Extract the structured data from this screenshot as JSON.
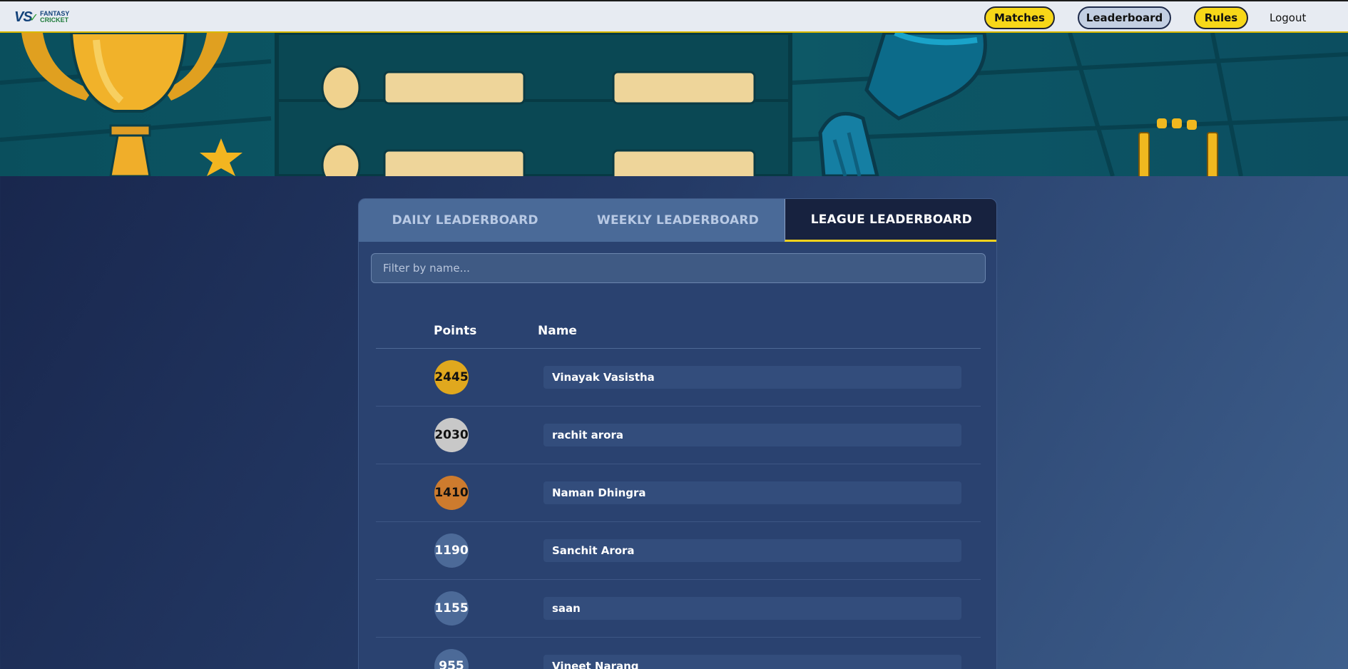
{
  "nav": {
    "logo_text": "VS",
    "logo_brand_top": "FANTASY",
    "logo_brand_bottom": "CRICKET",
    "matches_label": "Matches",
    "leaderboard_label": "Leaderboard",
    "rules_label": "Rules",
    "logout_label": "Logout"
  },
  "tabs": [
    {
      "label": "DAILY LEADERBOARD",
      "active": false
    },
    {
      "label": "WEEKLY LEADERBOARD",
      "active": false
    },
    {
      "label": "LEAGUE LEADERBOARD",
      "active": true
    }
  ],
  "filter": {
    "placeholder": "Filter by name...",
    "value": ""
  },
  "table": {
    "headers": {
      "points": "Points",
      "name": "Name"
    },
    "rows": [
      {
        "points": "2445",
        "name": "Vinayak Vasistha",
        "badge_color": "#e0a81e"
      },
      {
        "points": "2030",
        "name": "rachit arora",
        "badge_color": "#c8c8c8"
      },
      {
        "points": "1410",
        "name": "Naman Dhingra",
        "badge_color": "#cd7b2e"
      },
      {
        "points": "1190",
        "name": "Sanchit Arora",
        "badge_color": "#4c6a98"
      },
      {
        "points": "1155",
        "name": "saan",
        "badge_color": "#4c6a98"
      },
      {
        "points": "955",
        "name": "Vineet Narang",
        "badge_color": "#4c6a98"
      }
    ]
  },
  "colors": {
    "accent_yellow": "#f7d718",
    "panel_bg": "#2a4270",
    "nav_bg": "#e7ebf2"
  }
}
